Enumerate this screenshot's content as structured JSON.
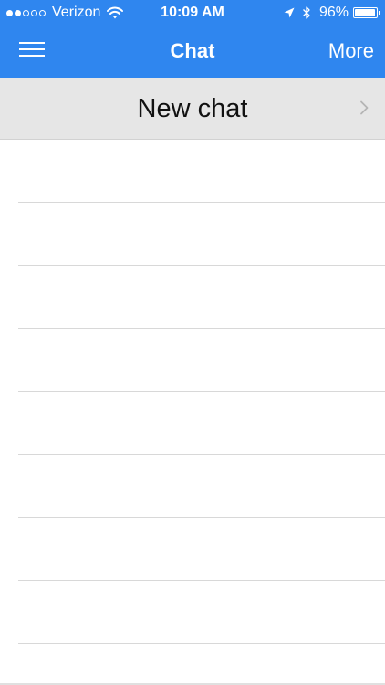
{
  "status_bar": {
    "signal_full": 2,
    "signal_total": 5,
    "carrier": "Verizon",
    "time": "10:09 AM",
    "battery_percent": "96%",
    "battery_level": 0.96,
    "icons": [
      "wifi-icon",
      "location-arrow-icon",
      "bluetooth-icon",
      "battery-icon"
    ]
  },
  "navbar": {
    "title": "Chat",
    "more_label": "More",
    "menu_icon": "hamburger-menu-icon",
    "background_color": "#2f86ef"
  },
  "new_chat": {
    "label": "New chat",
    "icon": "chevron-right-icon"
  },
  "chat_list": {
    "rows": [
      {},
      {},
      {},
      {},
      {},
      {},
      {},
      {}
    ]
  }
}
